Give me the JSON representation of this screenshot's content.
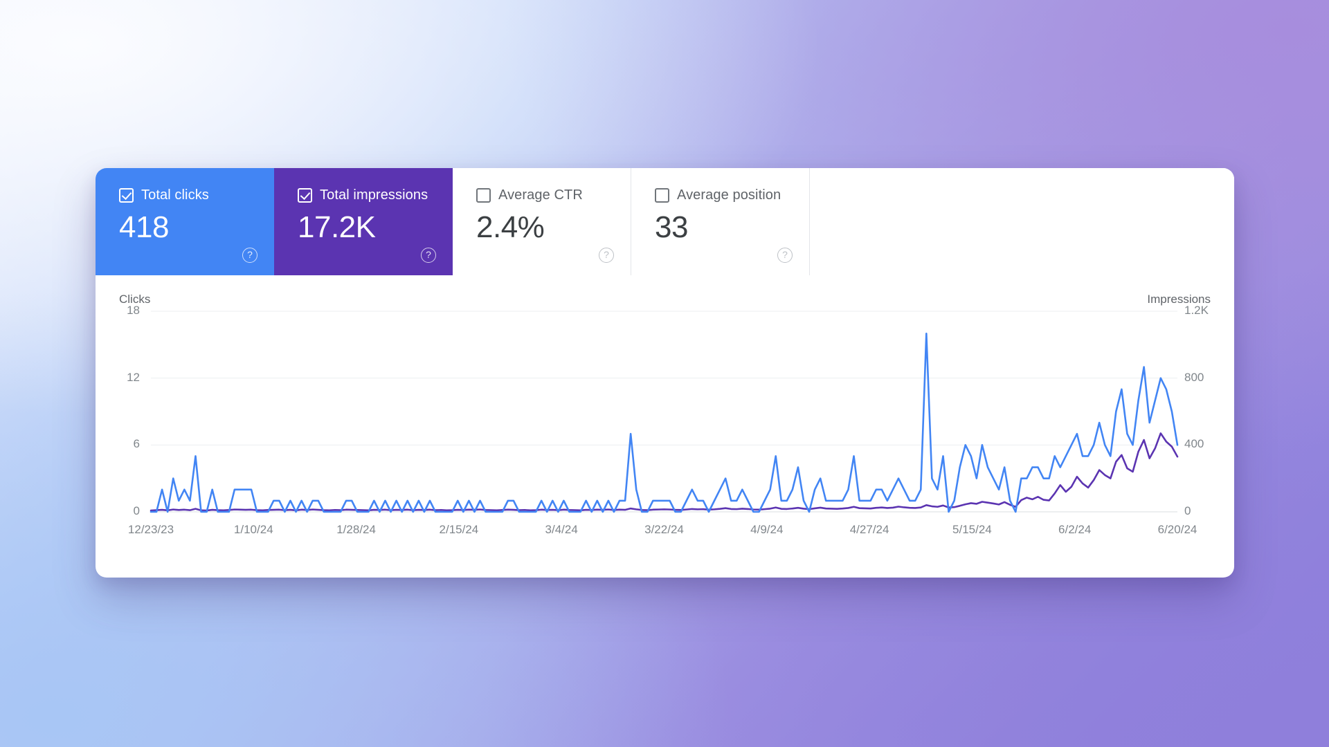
{
  "metrics": [
    {
      "label": "Total clicks",
      "value": "418",
      "checked": true,
      "style": "clicks",
      "help": "?"
    },
    {
      "label": "Total impressions",
      "value": "17.2K",
      "checked": true,
      "style": "impressions",
      "help": "?"
    },
    {
      "label": "Average CTR",
      "value": "2.4%",
      "checked": false,
      "style": "plain",
      "help": "?"
    },
    {
      "label": "Average position",
      "value": "33",
      "checked": false,
      "style": "plain",
      "help": "?"
    }
  ],
  "colors": {
    "clicks": "#4285f4",
    "impressions": "#5b34b1",
    "grid": "#eceff1",
    "axis_text": "#80868b"
  },
  "chart_data": {
    "type": "line",
    "title": "",
    "xlabel": "",
    "grid": true,
    "legend": "none",
    "left_axis": {
      "label": "Clicks",
      "ticks": [
        "0",
        "6",
        "12",
        "18"
      ],
      "ylim": [
        0,
        18
      ]
    },
    "right_axis": {
      "label": "Impressions",
      "ticks": [
        "0",
        "400",
        "800",
        "1.2K"
      ],
      "ylim": [
        0,
        1200
      ]
    },
    "x_tick_labels": [
      "12/23/23",
      "1/10/24",
      "1/28/24",
      "2/15/24",
      "3/4/24",
      "3/22/24",
      "4/9/24",
      "4/27/24",
      "5/15/24",
      "6/2/24",
      "6/20/24"
    ],
    "x_start": "12/23/23",
    "x_end": "6/20/24",
    "series": [
      {
        "name": "Clicks",
        "color": "#4285f4",
        "axis": "left",
        "values": [
          0,
          0,
          2,
          0,
          3,
          1,
          2,
          1,
          5,
          0,
          0,
          2,
          0,
          0,
          0,
          2,
          2,
          2,
          2,
          0,
          0,
          0,
          1,
          1,
          0,
          1,
          0,
          1,
          0,
          1,
          1,
          0,
          0,
          0,
          0,
          1,
          1,
          0,
          0,
          0,
          1,
          0,
          1,
          0,
          1,
          0,
          1,
          0,
          1,
          0,
          1,
          0,
          0,
          0,
          0,
          1,
          0,
          1,
          0,
          1,
          0,
          0,
          0,
          0,
          1,
          1,
          0,
          0,
          0,
          0,
          1,
          0,
          1,
          0,
          1,
          0,
          0,
          0,
          1,
          0,
          1,
          0,
          1,
          0,
          1,
          1,
          7,
          2,
          0,
          0,
          1,
          1,
          1,
          1,
          0,
          0,
          1,
          2,
          1,
          1,
          0,
          1,
          2,
          3,
          1,
          1,
          2,
          1,
          0,
          0,
          1,
          2,
          5,
          1,
          1,
          2,
          4,
          1,
          0,
          2,
          3,
          1,
          1,
          1,
          1,
          2,
          5,
          1,
          1,
          1,
          2,
          2,
          1,
          2,
          3,
          2,
          1,
          1,
          2,
          16,
          3,
          2,
          5,
          0,
          1,
          4,
          6,
          5,
          3,
          6,
          4,
          3,
          2,
          4,
          1,
          0,
          3,
          3,
          4,
          4,
          3,
          3,
          5,
          4,
          5,
          6,
          7,
          5,
          5,
          6,
          8,
          6,
          5,
          9,
          11,
          7,
          6,
          10,
          13,
          8,
          10,
          12,
          11,
          9,
          6
        ]
      },
      {
        "name": "Impressions",
        "color": "#5b34b1",
        "axis": "right",
        "values": [
          8,
          10,
          12,
          9,
          14,
          11,
          13,
          10,
          18,
          9,
          8,
          12,
          10,
          9,
          11,
          14,
          13,
          12,
          13,
          10,
          9,
          11,
          12,
          13,
          10,
          12,
          9,
          13,
          11,
          14,
          12,
          10,
          9,
          11,
          10,
          13,
          12,
          11,
          10,
          9,
          12,
          11,
          13,
          10,
          12,
          11,
          13,
          10,
          12,
          11,
          13,
          10,
          11,
          9,
          10,
          12,
          11,
          13,
          12,
          14,
          11,
          10,
          9,
          11,
          13,
          12,
          10,
          11,
          9,
          10,
          13,
          11,
          12,
          10,
          13,
          11,
          10,
          9,
          12,
          11,
          13,
          12,
          14,
          11,
          13,
          12,
          20,
          15,
          11,
          10,
          13,
          14,
          15,
          14,
          12,
          11,
          14,
          17,
          15,
          16,
          13,
          15,
          18,
          22,
          17,
          16,
          19,
          17,
          14,
          13,
          16,
          19,
          26,
          18,
          17,
          20,
          24,
          19,
          16,
          21,
          25,
          20,
          19,
          18,
          20,
          23,
          30,
          22,
          21,
          20,
          24,
          26,
          23,
          25,
          31,
          27,
          24,
          23,
          26,
          40,
          33,
          30,
          38,
          26,
          28,
          36,
          45,
          52,
          48,
          60,
          55,
          50,
          44,
          58,
          42,
          30,
          70,
          85,
          75,
          90,
          72,
          68,
          110,
          160,
          120,
          150,
          210,
          170,
          145,
          190,
          250,
          220,
          200,
          300,
          340,
          260,
          240,
          360,
          430,
          320,
          380,
          470,
          420,
          390,
          330
        ]
      }
    ]
  }
}
